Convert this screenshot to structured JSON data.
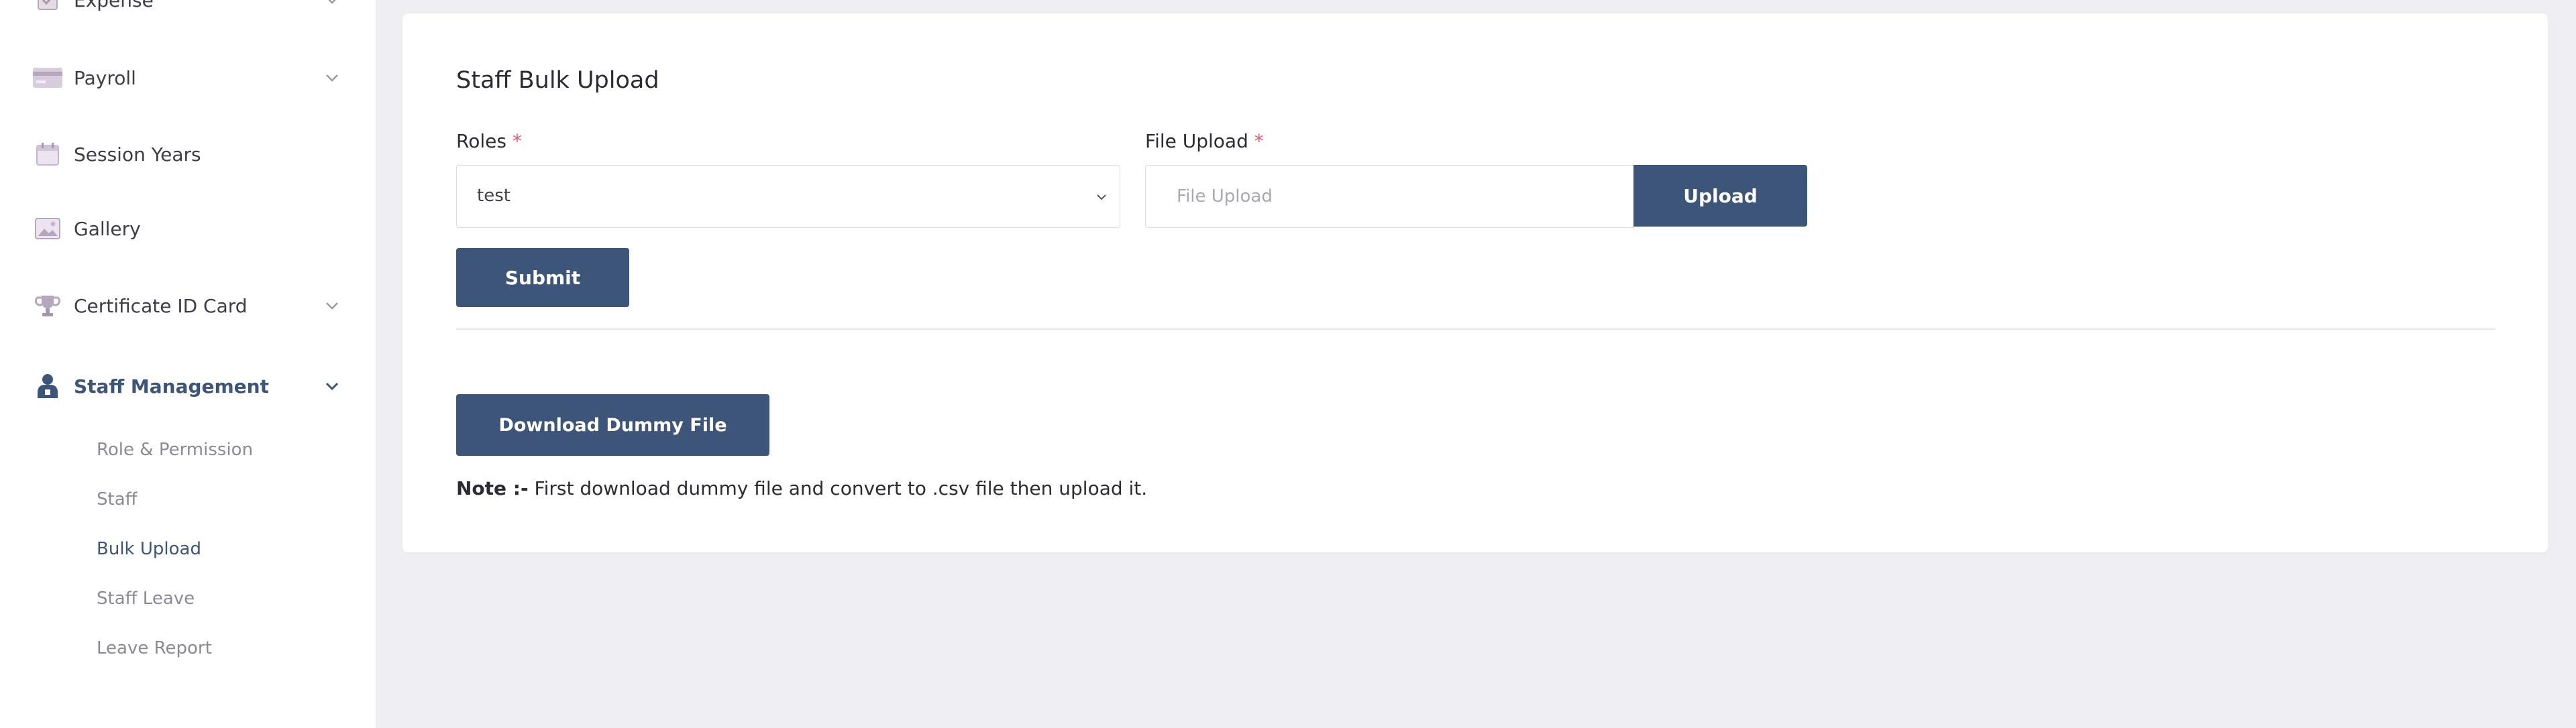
{
  "sidebar": {
    "items": [
      {
        "label": "Expense",
        "icon": "receipt-icon"
      },
      {
        "label": "Payroll",
        "icon": "credit-card-icon"
      },
      {
        "label": "Session Years",
        "icon": "calendar-icon"
      },
      {
        "label": "Gallery",
        "icon": "image-icon"
      },
      {
        "label": "Certificate ID Card",
        "icon": "trophy-icon"
      },
      {
        "label": "Staff Management",
        "icon": "staff-icon"
      }
    ],
    "submenu": [
      {
        "label": "Role & Permission"
      },
      {
        "label": "Staff"
      },
      {
        "label": "Bulk Upload"
      },
      {
        "label": "Staff Leave"
      },
      {
        "label": "Leave Report"
      }
    ]
  },
  "form": {
    "title": "Staff Bulk Upload",
    "roles_label": "Roles",
    "roles_value": "test",
    "file_label": "File Upload",
    "required_mark": "*",
    "file_placeholder": "File Upload",
    "upload_label": "Upload",
    "submit_label": "Submit",
    "download_label": "Download Dummy File",
    "note_prefix": "Note :-",
    "note_text": " First download dummy file and convert to .csv file then upload it."
  },
  "colors": {
    "accent": "#3c5578",
    "background": "#efeef3",
    "required": "#e3576b"
  }
}
